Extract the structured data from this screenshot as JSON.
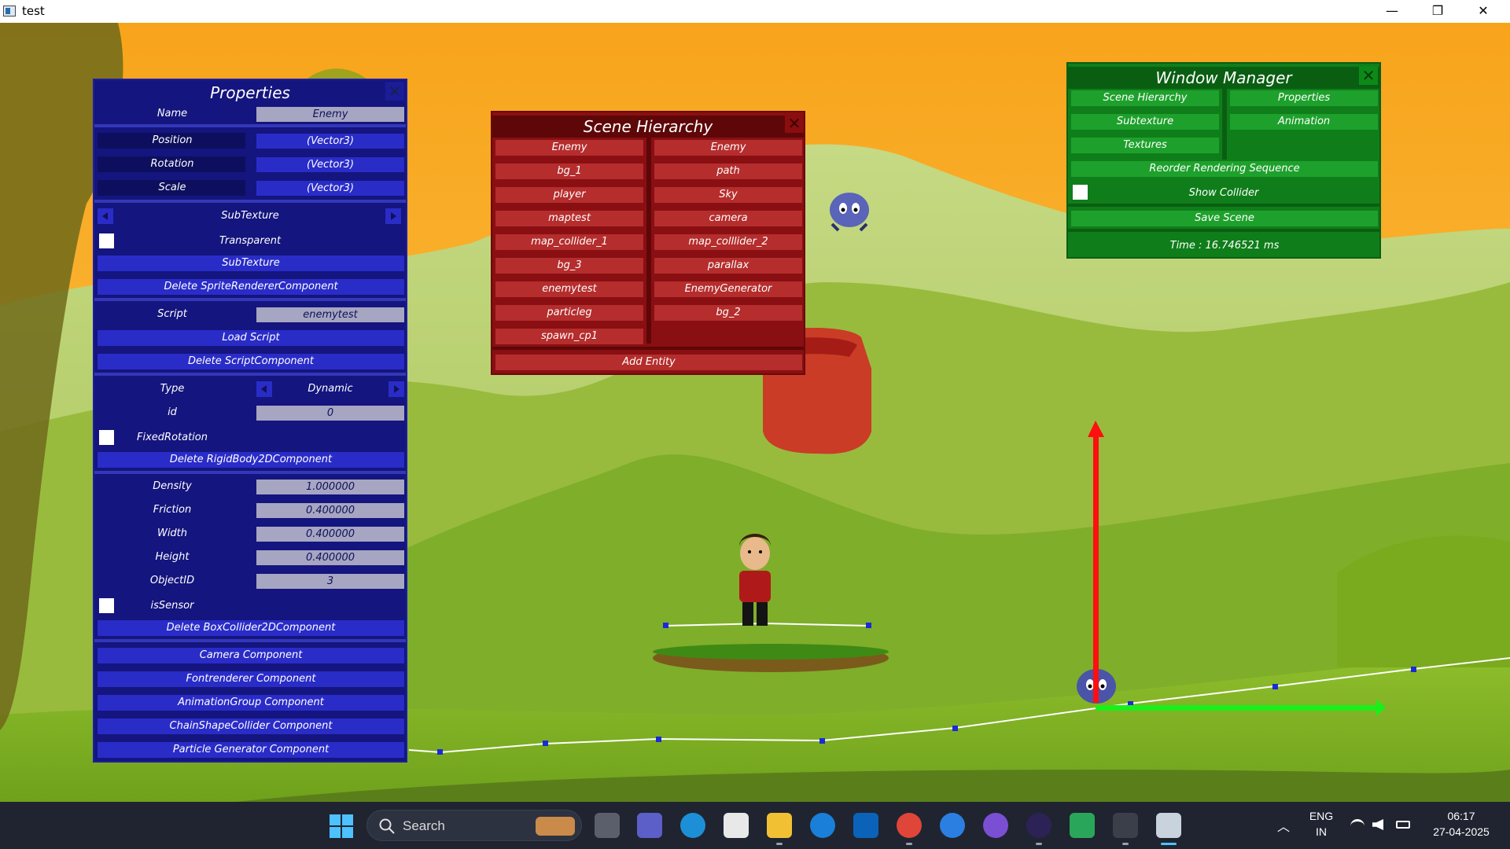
{
  "window": {
    "title": "test",
    "minimize": "—",
    "maximize": "❐",
    "close": "✕"
  },
  "properties": {
    "title": "Properties",
    "close": "✕",
    "name_label": "Name",
    "name_value": "Enemy",
    "position_label": "Position",
    "position_value": "(Vector3)",
    "rotation_label": "Rotation",
    "rotation_value": "(Vector3)",
    "scale_label": "Scale",
    "scale_value": "(Vector3)",
    "subtexture_label": "SubTexture",
    "transparent_label": "Transparent",
    "subtexture_button": "SubTexture",
    "delete_sprite": "Delete SpriteRendererComponent",
    "script_label": "Script",
    "script_value": "enemytest",
    "load_script": "Load Script",
    "delete_script": "Delete ScriptComponent",
    "type_label": "Type",
    "type_value": "Dynamic",
    "id_label": "id",
    "id_value": "0",
    "fixed_rotation_label": "FixedRotation",
    "delete_rigidbody": "Delete RigidBody2DComponent",
    "density_label": "Density",
    "density_value": "1.000000",
    "friction_label": "Friction",
    "friction_value": "0.400000",
    "width_label": "Width",
    "width_value": "0.400000",
    "height_label": "Height",
    "height_value": "0.400000",
    "objectid_label": "ObjectID",
    "objectid_value": "3",
    "issensor_label": "isSensor",
    "delete_boxcollider": "Delete BoxCollider2DComponent",
    "add_components": [
      "Camera Component",
      "Fontrenderer Component",
      "AnimationGroup Component",
      "ChainShapeCollider Component",
      "Particle Generator Component"
    ]
  },
  "hierarchy": {
    "title": "Scene Hierarchy",
    "close": "✕",
    "left": [
      "Enemy",
      "bg_1",
      "player",
      "maptest",
      "map_collider_1",
      "bg_3",
      "enemytest",
      "particleg",
      "spawn_cp1"
    ],
    "right": [
      "Enemy",
      "path",
      "Sky",
      "camera",
      "map_colllider_2",
      "parallax",
      "EnemyGenerator",
      "bg_2"
    ],
    "add_entity": "Add Entity"
  },
  "window_manager": {
    "title": "Window Manager",
    "close": "✕",
    "scene_hierarchy": "Scene Hierarchy",
    "properties": "Properties",
    "subtexture": "Subtexture",
    "animation": "Animation",
    "textures": "Textures",
    "reorder": "Reorder Rendering Sequence",
    "show_collider": "Show Collider",
    "save_scene": "Save Scene",
    "time": "Time : 16.746521 ms"
  },
  "taskbar": {
    "search_placeholder": "Search",
    "lang_top": "ENG",
    "lang_bottom": "IN",
    "time": "06:17",
    "date": "27-04-2025",
    "icons": [
      "start-icon",
      "search-icon",
      "task-view-icon",
      "teams-icon",
      "edge-icon",
      "store-icon",
      "file-explorer-icon",
      "help-icon",
      "myhp-icon",
      "chrome-icon",
      "sync-icon",
      "emacs-icon",
      "eclipse-icon",
      "app-icon",
      "terminal-icon",
      "game-window-icon"
    ]
  },
  "colors": {
    "properties_bg": "#14157e",
    "hierarchy_bg": "#8a0f12",
    "window_manager_bg": "#0f7e1a",
    "sky": "#f5a21e"
  }
}
